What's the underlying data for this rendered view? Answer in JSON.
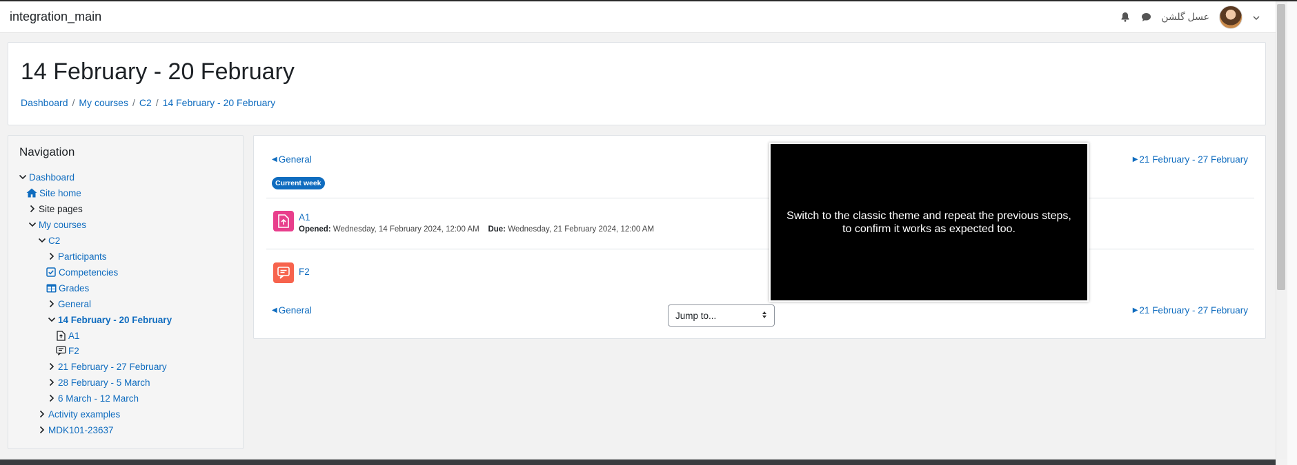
{
  "navbar": {
    "brand": "integration_main",
    "username": "عسل گلشن",
    "icons": [
      "bell-icon",
      "chat-icon",
      "chevron-down-icon"
    ]
  },
  "header": {
    "title": "14 February - 20 February",
    "breadcrumb": [
      "Dashboard",
      "My courses",
      "C2",
      "14 February - 20 February"
    ]
  },
  "navigation": {
    "title": "Navigation",
    "items": [
      {
        "label": "Dashboard"
      },
      {
        "label": "Site home"
      },
      {
        "label": "Site pages"
      },
      {
        "label": "My courses"
      },
      {
        "label": "C2"
      },
      {
        "label": "Participants"
      },
      {
        "label": "Competencies"
      },
      {
        "label": "Grades"
      },
      {
        "label": "General"
      },
      {
        "label": "14 February - 20 February"
      },
      {
        "label": "A1"
      },
      {
        "label": "F2"
      },
      {
        "label": "21 February - 27 February"
      },
      {
        "label": "28 February - 5 March"
      },
      {
        "label": "6 March - 12 March"
      },
      {
        "label": "Activity examples"
      },
      {
        "label": "MDK101-23637"
      }
    ]
  },
  "section": {
    "prev_label": "General",
    "next_label": "21 February - 27 February",
    "badge": "Current week",
    "activities": [
      {
        "name": "A1",
        "opened_label": "Opened:",
        "opened_value": "Wednesday, 14 February 2024, 12:00 AM",
        "due_label": "Due:",
        "due_value": "Wednesday, 21 February 2024, 12:00 AM",
        "color": "#e83e8c"
      },
      {
        "name": "F2",
        "color": "#f7634d"
      }
    ],
    "jump_to": "Jump to..."
  },
  "tour": {
    "message": "Switch to the classic theme and repeat the previous steps, to confirm it works as expected too."
  },
  "colors": {
    "link": "#0f6cbf",
    "badge": "#0f6cbf",
    "assign_icon": "#e83e8c",
    "feedback_icon": "#f7634d"
  }
}
